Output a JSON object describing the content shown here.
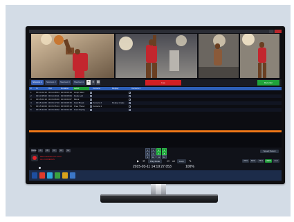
{
  "app": {
    "tabs": [
      "Shortcut 1",
      "Shortcut 2",
      "Shortcut 3",
      "Shortcut 4"
    ],
    "live_label": "Live",
    "green_label": "Recorder"
  },
  "clips": {
    "headers": [
      "#",
      "In",
      "Out",
      "Duration",
      "Label",
      "Camera",
      "Replay",
      "Camera 2"
    ],
    "rows": [
      [
        "1",
        "00:14:22:10",
        "00:14:28:04",
        "00:00:05:19",
        "Hoop Slam",
        "",
        "",
        ""
      ],
      [
        "2",
        "00:14:35:02",
        "00:14:40:11",
        "00:00:05:09",
        "Dunk Left",
        "",
        "",
        ""
      ],
      [
        "3",
        "00:15:01:18",
        "00:15:06:00",
        "00:00:04:07",
        "Block",
        "",
        "",
        ""
      ],
      [
        "4",
        "00:15:12:05",
        "00:15:17:20",
        "00:00:05:15",
        "Fast Break",
        "Camera 2",
        "Replay Angle",
        ""
      ],
      [
        "5",
        "00:15:30:00",
        "00:15:35:14",
        "00:00:05:14",
        "Free Throw",
        "Camera 1",
        "",
        ""
      ],
      [
        "6",
        "00:15:44:09",
        "00:15:49:02",
        "00:00:04:18",
        "Foul Replay",
        "",
        "",
        ""
      ]
    ]
  },
  "controls": {
    "left_buttons": [
      "Show",
      "A",
      "B",
      "C",
      "D",
      "E"
    ],
    "rec_text": [
      "RECORDING 00:14:22",
      "ALL CAMERAS"
    ],
    "grid": [
      "1",
      "2",
      "3",
      "4",
      "5",
      "6",
      "7",
      "8",
      "9",
      "10",
      "11",
      "12"
    ],
    "grid_on": [
      2,
      3,
      6,
      7
    ],
    "take_label": "Play Mode",
    "loop_label": "Loop",
    "timecode": "2015-03-11 14:19:27.053",
    "speed": "100%",
    "right_top": "Speed Select",
    "right_buttons": [
      "25%",
      "50%",
      "75%",
      "100%",
      "Full"
    ],
    "right_active": 3
  },
  "taskbar": {
    "items": [
      "start",
      "explorer",
      "browser",
      "store",
      "app",
      "folder"
    ],
    "colors": [
      "#1e4fa0",
      "#e03b2b",
      "#2fa6dc",
      "#3aa23f",
      "#d9a21b",
      "#3b77c8"
    ]
  },
  "colors": {
    "accent_blue": "#2d5fb8",
    "record_red": "#d11f25",
    "go_green": "#1fa33a",
    "playhead_orange": "#f07818"
  }
}
